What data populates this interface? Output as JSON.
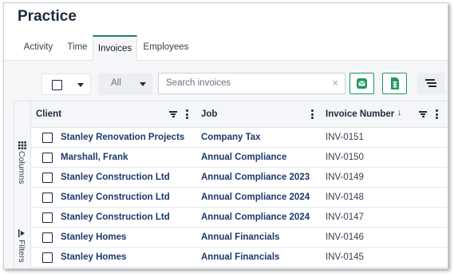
{
  "page": {
    "title": "Practice"
  },
  "tabs": [
    {
      "label": "Activity"
    },
    {
      "label": "Time"
    },
    {
      "label": "Invoices",
      "active": true
    },
    {
      "label": "Employees"
    }
  ],
  "toolbar": {
    "filter_label": "All",
    "search_placeholder": "Search invoices",
    "search_clear": "×",
    "accent": "#1d9a5a"
  },
  "side_tabs": {
    "columns_label": "Columns",
    "filters_label": "Filters"
  },
  "grid": {
    "columns": [
      {
        "label": "Client"
      },
      {
        "label": "Job"
      },
      {
        "label": "Invoice Number",
        "sort": "↓"
      }
    ],
    "rows": [
      {
        "client": "Stanley Renovation Projects",
        "job": "Company Tax",
        "invoice": "INV-0151"
      },
      {
        "client": "Marshall, Frank",
        "job": "Annual Compliance",
        "invoice": "INV-0150"
      },
      {
        "client": "Stanley Construction Ltd",
        "job": "Annual Compliance 2023",
        "invoice": "INV-0149"
      },
      {
        "client": "Stanley Construction Ltd",
        "job": "Annual Compliance 2024",
        "invoice": "INV-0148"
      },
      {
        "client": "Stanley Construction Ltd",
        "job": "Annual Compliance 2024",
        "invoice": "INV-0147"
      },
      {
        "client": "Stanley Homes",
        "job": "Annual Financials",
        "invoice": "INV-0146"
      },
      {
        "client": "Stanley Homes",
        "job": "Annual Financials",
        "invoice": "INV-0145"
      }
    ]
  }
}
